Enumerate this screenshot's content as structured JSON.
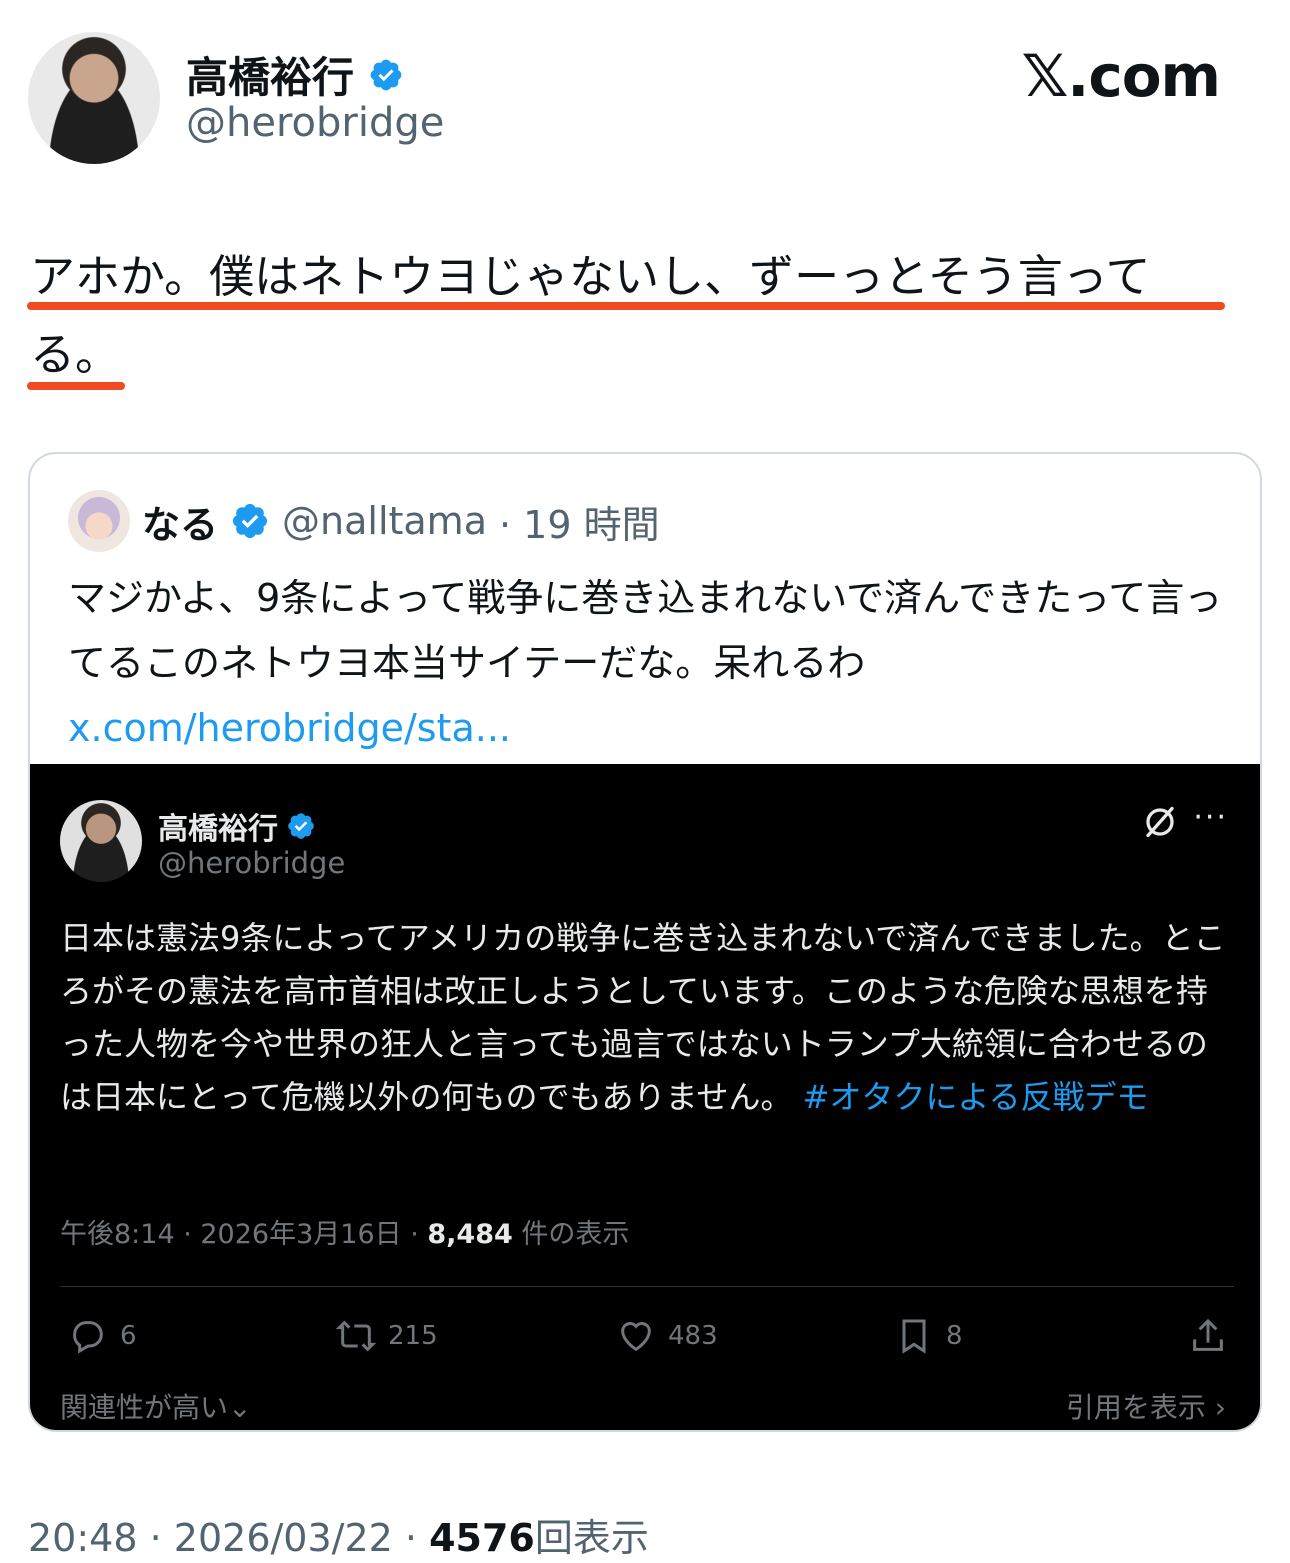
{
  "author": {
    "name": "高橋裕行",
    "handle": "@herobridge"
  },
  "brand": "𝕏.com",
  "post": {
    "text": "アホか。僕はネトウヨじゃないし、ずーっとそう言ってる。",
    "time": "20:48",
    "date": "2026/03/22",
    "views": "4576",
    "views_label": "回表示",
    "sep": "·"
  },
  "quote": {
    "name": "なる",
    "handle": "@nalltama",
    "time": "· 19 時間",
    "text": "マジかよ、9条によって戦争に巻き込まれないで済んできたって言ってるこのネトウヨ本当サイテーだな。呆れるわ",
    "link": "x.com/herobridge/sta..."
  },
  "embedded": {
    "name": "高橋裕行",
    "handle": "@herobridge",
    "more": "···",
    "text": "日本は憲法9条によってアメリカの戦争に巻き込まれないで済んできました。ところがその憲法を高市首相は改正しようとしています。このような危険な思想を持った人物を今や世界の狂人と言っても過言ではないトランプ大統領に合わせるのは日本にとって危機以外の何ものでもありません。",
    "hashtag": "#オタクによる反戦デモ",
    "meta_time": "午後8:14 · 2026年3月16日 · ",
    "meta_views": "8,484",
    "meta_views_label": " 件の表示",
    "actions": {
      "replies": "6",
      "reposts": "215",
      "likes": "483",
      "bookmarks": "8"
    },
    "footer_left": "関連性が高い⌄",
    "footer_right": "引用を表示 ›"
  },
  "colors": {
    "accent": "#1d9bf0",
    "underline": "#f04a23",
    "secondary_text": "#536471"
  }
}
